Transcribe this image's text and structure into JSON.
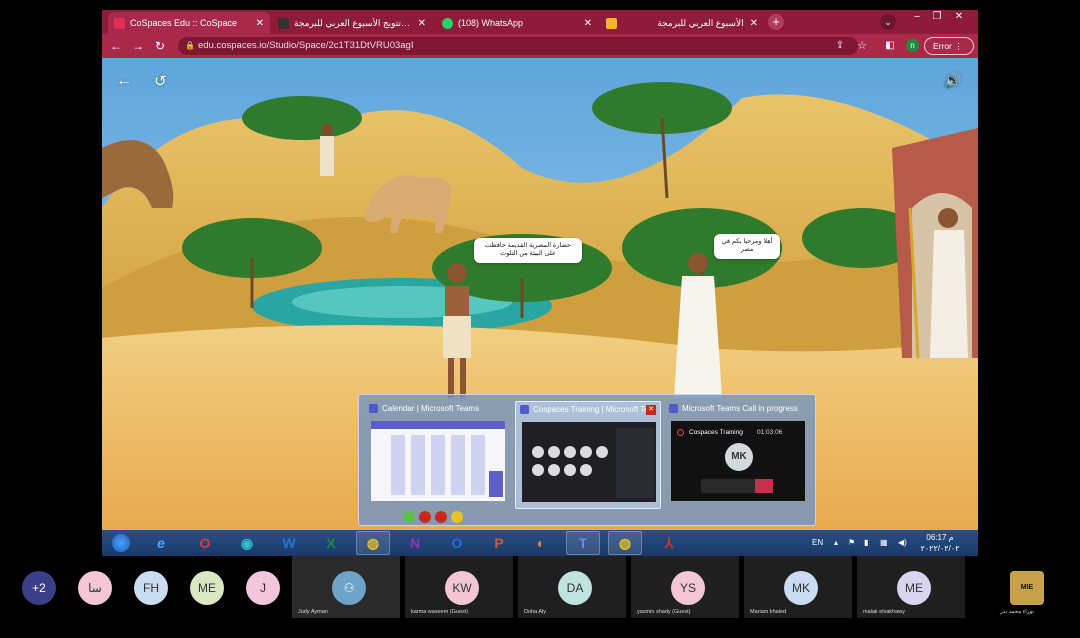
{
  "browser": {
    "tabs": [
      {
        "label": "CoSpaces Edu :: CoSpace",
        "active": true,
        "favicon_color": "#e0305a"
      },
      {
        "label": "حفل تتويج الأسبوع العربي للبرمجة | Flickr",
        "active": false,
        "favicon_color": "#333333"
      },
      {
        "label": "(108) WhatsApp",
        "active": false,
        "favicon_color": "#25d366"
      },
      {
        "label": "الأسبوع العربي للبرمجة",
        "active": false,
        "favicon_color": "#f5b52b"
      }
    ],
    "new_tab": "+",
    "url": "edu.cospaces.io/Studio/Space/2c1T31DtVRU03agI",
    "profile_initial": "n",
    "error_label": "Error"
  },
  "scene": {
    "bubble_left": "حضارة المصرية القديمة حافظت على البيئة من التلوث",
    "bubble_right": "أهلا ومرحبا بكم في مصر"
  },
  "thumbnails": [
    {
      "title": "Calendar | Microsoft Teams",
      "selected": false
    },
    {
      "title": "Cospaces Training | Microsoft Teams",
      "selected": true
    },
    {
      "title": "Microsoft Teams Call in progress",
      "selected": false,
      "call_name": "Cospaces Training",
      "call_time": "01:03:06",
      "initials": "MK"
    }
  ],
  "taskbar": {
    "language": "EN",
    "time": "06:17 م",
    "date": "٢٠٢٢/٠٢/٠٢"
  },
  "participants": {
    "overflow": "+2",
    "small": [
      {
        "initials": "سا",
        "color": "#f4c7d6"
      },
      {
        "initials": "FH",
        "color": "#c9dcf2"
      },
      {
        "initials": "ME",
        "color": "#d9e8c2"
      },
      {
        "initials": "J",
        "color": "#f2c7dd"
      }
    ],
    "tiles": [
      {
        "initials": "",
        "name": "Judy Ayman",
        "color": "#6fa3c7",
        "highlight": true
      },
      {
        "initials": "KW",
        "name": "karma waseem (Guest)",
        "color": "#f2c7d3"
      },
      {
        "initials": "DA",
        "name": "Doha Aly",
        "color": "#bfe3e0"
      },
      {
        "initials": "YS",
        "name": "yasmin shady (Guest)",
        "color": "#f4c7d6"
      },
      {
        "initials": "MK",
        "name": "Mariam khaled",
        "color": "#c9dcf2"
      },
      {
        "initials": "ME",
        "name": "malak elsakhawy",
        "color": "#d9d4ef"
      },
      {
        "initials": "",
        "name": "نوراء محمد بدر",
        "color": "#000000"
      }
    ]
  }
}
